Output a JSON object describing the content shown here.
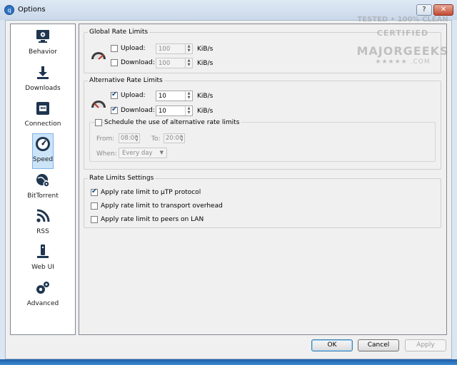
{
  "window": {
    "title": "Options",
    "help_label": "?",
    "close_label": "✕"
  },
  "sidebar": {
    "items": [
      {
        "label": "Behavior",
        "icon": "monitor-gear-icon"
      },
      {
        "label": "Downloads",
        "icon": "download-arrow-icon"
      },
      {
        "label": "Connection",
        "icon": "network-port-icon"
      },
      {
        "label": "Speed",
        "icon": "speedometer-icon"
      },
      {
        "label": "BitTorrent",
        "icon": "globe-gear-icon"
      },
      {
        "label": "RSS",
        "icon": "rss-feed-icon"
      },
      {
        "label": "Web UI",
        "icon": "web-remote-icon"
      },
      {
        "label": "Advanced",
        "icon": "gears-icon"
      }
    ],
    "active_index": 3
  },
  "global_limits": {
    "title": "Global Rate Limits",
    "upload_label": "Upload:",
    "upload_checked": false,
    "upload_value": "100",
    "download_label": "Download:",
    "download_checked": false,
    "download_value": "100",
    "unit": "KiB/s"
  },
  "alt_limits": {
    "title": "Alternative Rate Limits",
    "upload_label": "Upload:",
    "upload_checked": true,
    "upload_value": "10",
    "download_label": "Download:",
    "download_checked": true,
    "download_value": "10",
    "unit": "KiB/s",
    "schedule_label": "Schedule the use of alternative rate limits",
    "schedule_checked": false,
    "from_label": "From:",
    "from_value": "08:00",
    "to_label": "To:",
    "to_value": "20:00",
    "when_label": "When:",
    "when_value": "Every day"
  },
  "rate_settings": {
    "title": "Rate Limits Settings",
    "utp_label": "Apply rate limit to µTP protocol",
    "utp_checked": true,
    "overhead_label": "Apply rate limit to transport overhead",
    "overhead_checked": false,
    "lan_label": "Apply rate limit to peers on LAN",
    "lan_checked": false
  },
  "buttons": {
    "ok": "OK",
    "cancel": "Cancel",
    "apply": "Apply"
  },
  "watermark": {
    "line1": "TESTED • 100% CLEAN",
    "line2": "CERTIFIED",
    "line3": "MAJORGEEKS",
    "line4": "★★★★★ .COM"
  },
  "colors": {
    "accent": "#2f73c2",
    "selection": "#cce4f7",
    "gauge_red": "#c0392b"
  }
}
